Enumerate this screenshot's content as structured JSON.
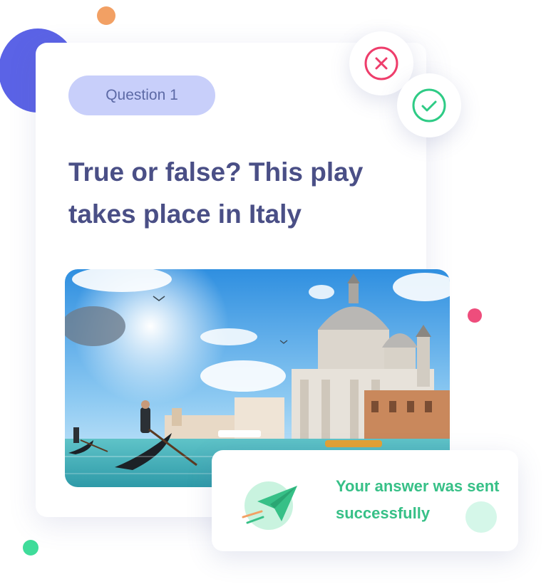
{
  "quiz_card": {
    "badge_label": "Question 1",
    "question_text": "True or false? This play takes place in Italy"
  },
  "answer_buttons": {
    "false_icon": "close-icon",
    "true_icon": "check-icon",
    "false_color": "#ee3d6b",
    "true_color": "#2ecb85"
  },
  "image": {
    "subject": "venice-grand-canal-gondolas-basilica-photo"
  },
  "toast": {
    "icon": "paper-plane-icon",
    "message": "Your answer was sent successfully",
    "color": "#37c087"
  },
  "colors": {
    "badge_bg": "#c8cffa",
    "question_text": "#4a4f86",
    "accent_blue": "#5b63e6",
    "accent_orange": "#f2a064",
    "accent_pink": "#ee4d7c",
    "accent_green": "#3fdc9a"
  }
}
